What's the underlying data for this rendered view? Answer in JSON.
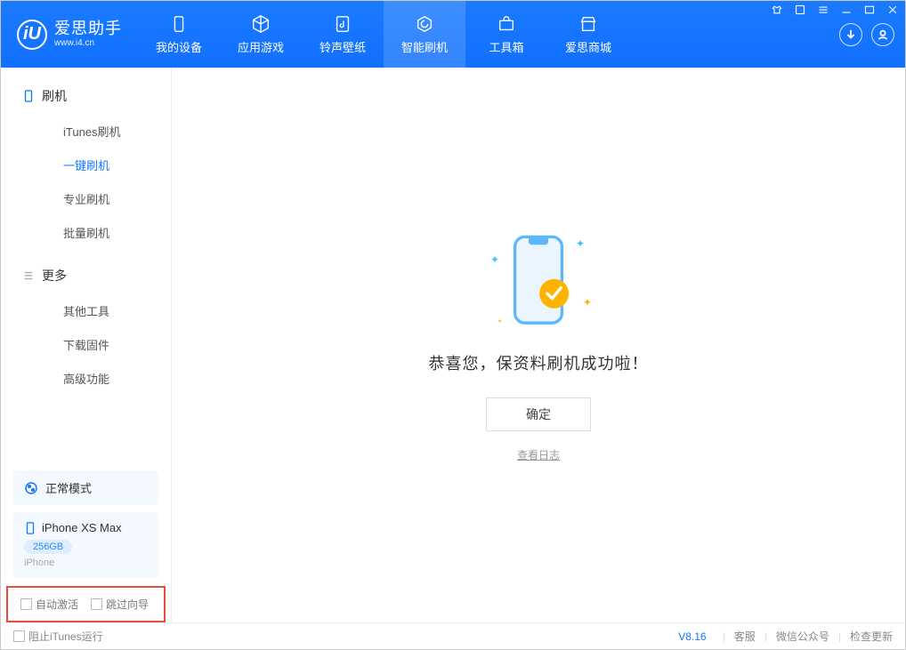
{
  "app": {
    "title": "爱思助手",
    "subtitle": "www.i4.cn"
  },
  "nav": {
    "items": [
      {
        "label": "我的设备"
      },
      {
        "label": "应用游戏"
      },
      {
        "label": "铃声壁纸"
      },
      {
        "label": "智能刷机"
      },
      {
        "label": "工具箱"
      },
      {
        "label": "爱思商城"
      }
    ]
  },
  "sidebar": {
    "section1": {
      "title": "刷机",
      "items": [
        {
          "label": "iTunes刷机"
        },
        {
          "label": "一键刷机"
        },
        {
          "label": "专业刷机"
        },
        {
          "label": "批量刷机"
        }
      ]
    },
    "section2": {
      "title": "更多",
      "items": [
        {
          "label": "其他工具"
        },
        {
          "label": "下载固件"
        },
        {
          "label": "高级功能"
        }
      ]
    },
    "mode": {
      "label": "正常模式"
    },
    "device": {
      "name": "iPhone XS Max",
      "capacity": "256GB",
      "type": "iPhone"
    },
    "checks": {
      "auto_activate": "自动激活",
      "skip_guide": "跳过向导"
    }
  },
  "main": {
    "success": "恭喜您，保资料刷机成功啦！",
    "ok": "确定",
    "view_log": "查看日志"
  },
  "statusbar": {
    "block_itunes": "阻止iTunes运行",
    "version": "V8.16",
    "links": {
      "service": "客服",
      "wechat": "微信公众号",
      "update": "检查更新"
    }
  }
}
